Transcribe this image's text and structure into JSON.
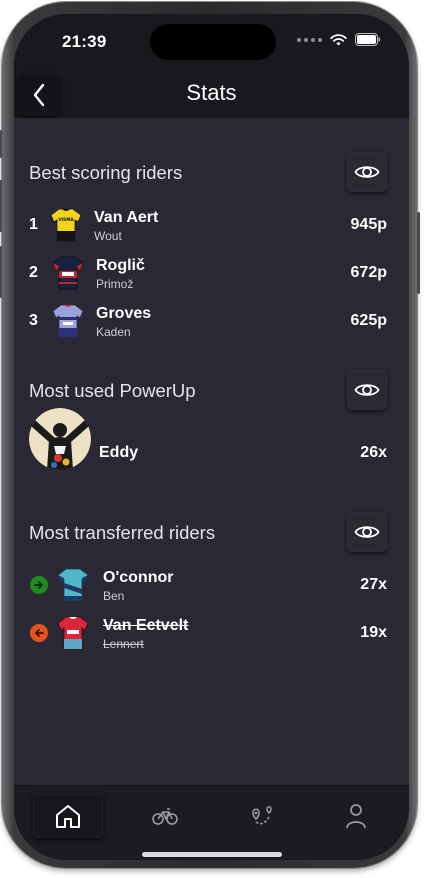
{
  "status_bar": {
    "time": "21:39"
  },
  "nav": {
    "title": "Stats",
    "back_icon": "chevron-left-icon"
  },
  "best_scoring": {
    "title": "Best scoring riders",
    "riders": [
      {
        "rank": "1",
        "last": "Van Aert",
        "first": "Wout",
        "points": "945p",
        "jersey": "yellow"
      },
      {
        "rank": "2",
        "last": "Roglič",
        "first": "Primož",
        "points": "672p",
        "jersey": "dark-blue"
      },
      {
        "rank": "3",
        "last": "Groves",
        "first": "Kaden",
        "points": "625p",
        "jersey": "lavender"
      }
    ]
  },
  "most_used_powerup": {
    "title": "Most used PowerUp",
    "name": "Eddy",
    "count": "26x"
  },
  "most_transferred": {
    "title": "Most transferred riders",
    "riders": [
      {
        "last": "O'connor",
        "first": "Ben",
        "count": "27x",
        "direction": "in",
        "color": "#1f8a1f"
      },
      {
        "last": "Van Eetvelt",
        "first": "Lennert",
        "count": "19x",
        "direction": "out",
        "color": "#e2531d"
      }
    ]
  },
  "tabs": [
    {
      "name": "home",
      "icon": "home-icon",
      "active": true
    },
    {
      "name": "bike",
      "icon": "bicycle-icon",
      "active": false
    },
    {
      "name": "route",
      "icon": "route-icon",
      "active": false
    },
    {
      "name": "profile",
      "icon": "person-icon",
      "active": false
    }
  ]
}
